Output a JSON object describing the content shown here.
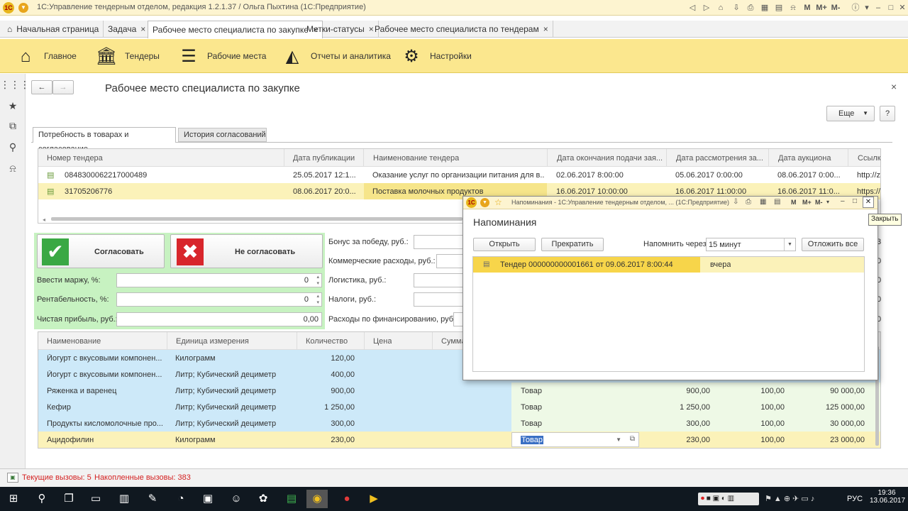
{
  "window": {
    "title": "1С:Управление тендерным отделом, редакция 1.2.1.37 / Ольга Пыхтина  (1С:Предприятие)",
    "logo": "1С"
  },
  "tabs": [
    {
      "label": "Начальная страница"
    },
    {
      "label": "Задача"
    },
    {
      "label": "Рабочее место специалиста по закупке"
    },
    {
      "label": "Метки-статусы"
    },
    {
      "label": "Рабочее место специалиста по тендерам"
    }
  ],
  "tab_close": "×",
  "menu": [
    {
      "label": "Главное",
      "icon": "home-icon"
    },
    {
      "label": "Тендеры",
      "icon": "bank-icon"
    },
    {
      "label": "Рабочие места",
      "icon": "list-icon"
    },
    {
      "label": "Отчеты и аналитика",
      "icon": "chart-icon"
    },
    {
      "label": "Настройки",
      "icon": "gears-icon"
    }
  ],
  "page": {
    "title": "Рабочее место специалиста по закупке",
    "more": "Еще",
    "help": "?",
    "back": "←",
    "forward": "→",
    "close": "×"
  },
  "subtabs": [
    "Потребность в товарах и согласование",
    "История согласований"
  ],
  "tenders": {
    "headers": [
      "Номер тендера",
      "Дата публикации",
      "Наименование тендера",
      "Дата окончания подачи зая...",
      "Дата рассмотрения за...",
      "Дата аукциона",
      "Ссылка"
    ],
    "rows": [
      [
        "0848300062217000489",
        "25.05.2017 12:1...",
        "Оказание услуг по организации питания для в...",
        "02.06.2017 8:00:00",
        "05.06.2017 0:00:00",
        "08.06.2017 0:00...",
        "http://z"
      ],
      [
        "31705206776",
        "08.06.2017 20:0...",
        "Поставка молочных продуктов",
        "16.06.2017 10:00:00",
        "16.06.2017 11:00:00",
        "16.06.2017 11:0...",
        "https://"
      ]
    ]
  },
  "approve": {
    "yes": "Согласовать",
    "no": "Не согласовать"
  },
  "params": [
    {
      "label": "Ввести маржу, %:",
      "value": "0"
    },
    {
      "label": "Рентабельность, %:",
      "value": "0"
    },
    {
      "label": "Чистая прибыль, руб.:",
      "value": "0,00"
    }
  ],
  "costs": [
    "Бонус за победу, руб.:",
    "Коммерческие расходы, руб.:",
    "Логистика, руб.:",
    "Налоги, руб.:",
    "Расходы по финансированию, руб.:"
  ],
  "goods": {
    "headers": [
      "Наименование",
      "Единица измерения",
      "Количество",
      "Цена",
      "Сумма"
    ],
    "rows": [
      {
        "name": "Йогурт с вкусовыми компонен...",
        "unit": "Килограмм",
        "qty": "120,00",
        "type": "",
        "q2": "",
        "price": "",
        "sum": ""
      },
      {
        "name": "Йогурт с вкусовыми компонен...",
        "unit": "Литр; Кубический дециметр",
        "qty": "400,00",
        "type": "",
        "q2": "",
        "price": "",
        "sum": ""
      },
      {
        "name": "Ряженка и варенец",
        "unit": "Литр; Кубический дециметр",
        "qty": "900,00",
        "type": "Товар",
        "q2": "900,00",
        "price": "100,00",
        "sum": "90 000,00"
      },
      {
        "name": "Кефир",
        "unit": "Литр; Кубический дециметр",
        "qty": "1 250,00",
        "type": "Товар",
        "q2": "1 250,00",
        "price": "100,00",
        "sum": "125 000,00"
      },
      {
        "name": "Продукты кисломолочные про...",
        "unit": "Литр; Кубический дециметр",
        "qty": "300,00",
        "type": "Товар",
        "q2": "300,00",
        "price": "100,00",
        "sum": "30 000,00"
      },
      {
        "name": "Ацидофилин",
        "unit": "Килограмм",
        "qty": "230,00",
        "type": "Товар",
        "q2": "230,00",
        "price": "100,00",
        "sum": "23 000,00"
      }
    ]
  },
  "right_clip": [
    "3",
    "0",
    "0",
    "0",
    "0"
  ],
  "dialog": {
    "title": "Напоминания - 1С:Управление тендерным отделом, ...  (1С:Предприятие)",
    "heading": "Напоминания",
    "open": "Открыть",
    "stop": "Прекратить",
    "remind_label": "Напомнить через:",
    "remind_value": "15 минут",
    "postpone": "Отложить все",
    "item": "Тендер 000000000001661 от 09.06.2017 8:00:44",
    "when": "вчера",
    "tooltip": "Закрыть"
  },
  "status": {
    "current": "Текущие вызовы: 5",
    "accum": "Накопленные вызовы: 383"
  },
  "taskbar": {
    "lang": "РУС",
    "time": "19:36",
    "date": "13.06.2017"
  }
}
